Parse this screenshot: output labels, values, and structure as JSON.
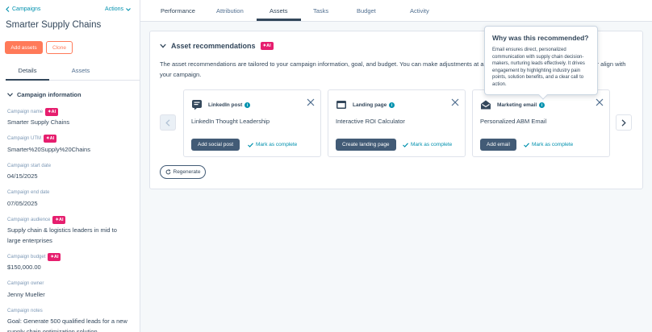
{
  "sidebar": {
    "back_label": "Campaigns",
    "actions_label": "Actions",
    "title": "Smarter Supply Chains",
    "add_assets_label": "Add assets",
    "clone_label": "Clone",
    "tabs": [
      {
        "label": "Details"
      },
      {
        "label": "Assets"
      }
    ],
    "section_title": "Campaign information",
    "ai_badge": "AI",
    "fields": [
      {
        "label": "Campaign name",
        "value": "Smarter Supply Chains"
      },
      {
        "label": "Campaign UTM",
        "value": "Smarter%20Supply%20Chains"
      },
      {
        "label": "Campaign start date",
        "value": "04/15/2025"
      },
      {
        "label": "Campaign end date",
        "value": "07/05/2025"
      },
      {
        "label": "Campaign audience",
        "value": "Supply chain & logistics leaders in mid to large enterprises"
      },
      {
        "label": "Campaign budget",
        "value": "$150,000.00"
      },
      {
        "label": "Campaign owner",
        "value": "Jenny Mueller"
      },
      {
        "label": "Campaign notes",
        "value": "Goal: Generate 500 qualified leads for a new supply chain optimization solution"
      }
    ]
  },
  "tabs": [
    {
      "label": "Performance"
    },
    {
      "label": "Attribution"
    },
    {
      "label": "Assets"
    },
    {
      "label": "Tasks"
    },
    {
      "label": "Budget"
    },
    {
      "label": "Activity"
    }
  ],
  "recommendations": {
    "title": "Asset recommendations",
    "ai_badge": "AI",
    "description": "The asset recommendations are tailored to your campaign information, goal, and budget. You can make adjustments at any time to get recommendations that better align with your campaign.",
    "cards": [
      {
        "type": "LinkedIn post",
        "name": "LinkedIn Thought Leadership",
        "button": "Add social post",
        "complete": "Mark as complete",
        "icon": "social-post-icon"
      },
      {
        "type": "Landing page",
        "name": "Interactive ROI Calculator",
        "button": "Create landing page",
        "complete": "Mark as complete",
        "icon": "landing-page-icon"
      },
      {
        "type": "Marketing email",
        "name": "Personalized ABM Email",
        "button": "Add email",
        "complete": "Mark as complete",
        "icon": "email-icon"
      }
    ],
    "regenerate_label": "Regenerate"
  },
  "tooltip": {
    "title": "Why was this recommended?",
    "body": "Email ensures direct, personalized communication with supply chain decision-makers, nurturing leads effectively. It drives engagement by highlighting industry pain points, solution benefits, and a clear call to action."
  },
  "colors": {
    "accent": "#ff7a59",
    "link": "#0091ae",
    "ai": "#e61e6e",
    "dark_button": "#425b76",
    "text": "#33475b"
  }
}
